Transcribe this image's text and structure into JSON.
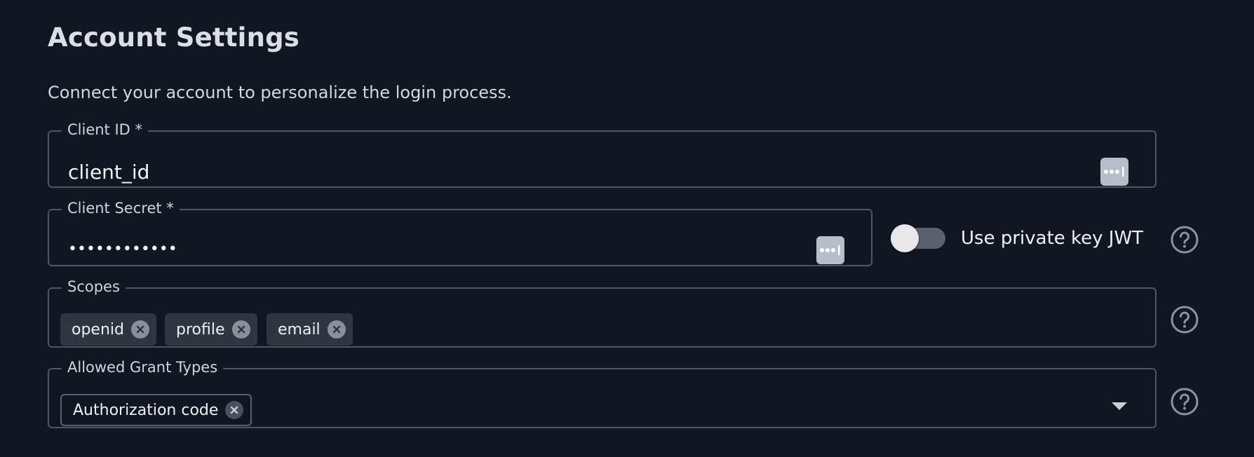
{
  "page": {
    "title": "Account Settings",
    "subtitle": "Connect your account to personalize the login process."
  },
  "client_id": {
    "label": "Client ID *",
    "value": "client_id",
    "icon": "password-manager-icon"
  },
  "client_secret": {
    "label": "Client Secret *",
    "masked_value": "••••••••••••",
    "icon": "password-manager-icon"
  },
  "private_key_jwt": {
    "label": "Use private key JWT",
    "enabled": false
  },
  "scopes": {
    "label": "Scopes",
    "chips": [
      "openid",
      "profile",
      "email"
    ]
  },
  "grant_types": {
    "label": "Allowed Grant Types",
    "chips": [
      "Authorization code"
    ]
  },
  "colors": {
    "background": "#111722",
    "border": "#4e5563",
    "chip": "#2f3541",
    "text": "#d8dde6"
  }
}
